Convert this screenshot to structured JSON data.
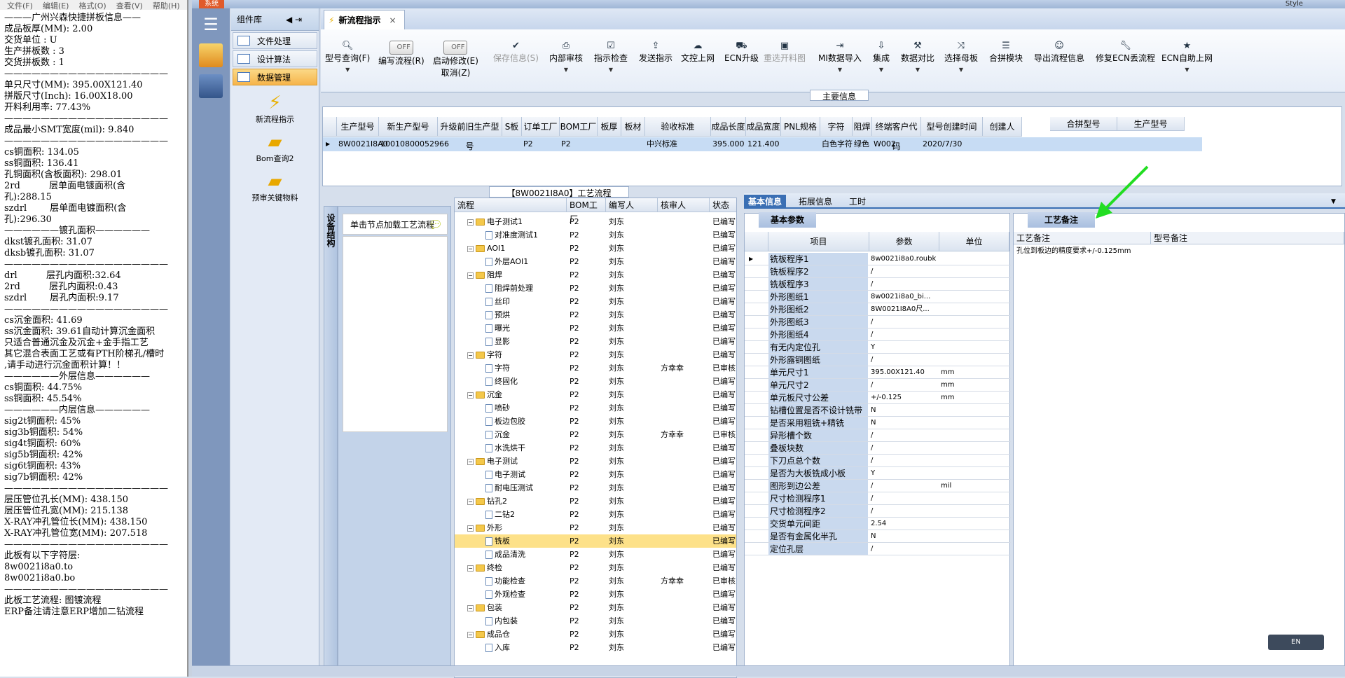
{
  "notepad": {
    "menu": [
      "文件(F)",
      "编辑(E)",
      "格式(O)",
      "查看(V)",
      "帮助(H)"
    ],
    "lines": [
      "———广州兴森快捷拼板信息——",
      "成品板厚(MM): 2.00",
      "交货单位 : U",
      "生产拼板数 : 3",
      "交货拼板数 : 1",
      "——————————————————",
      "单只尺寸(MM): 395.00X121.40",
      "拼版尺寸(Inch): 16.00X18.00",
      "开料利用率: 77.43%",
      "——————————————————",
      "成品最小SMT宽度(mil): 9.840",
      "——————————————————",
      "cs铜面积: 134.05",
      "ss铜面积: 136.41",
      "孔铜面积(含板面积): 298.01",
      "2rd          层单面电镀面积(含",
      "孔):288.15",
      "szdrl        层单面电镀面积(含",
      "孔):296.30",
      "",
      "——————镀孔面积——————",
      "dkst镀孔面积: 31.07",
      "dksb镀孔面积: 31.07",
      "",
      "——————————————————",
      "drl          层孔内面积:32.64",
      "2rd          层孔内面积:0.43",
      "szdrl        层孔内面积:9.17",
      "——————————————————",
      "",
      "cs沉金面积: 41.69",
      "ss沉金面积: 39.61自动计算沉金面积",
      "只适合普通沉金及沉金+金手指工艺",
      "其它混合表面工艺或有PTH阶梯孔/槽时",
      ",请手动进行沉金面积计算！！",
      "——————外层信息——————",
      "cs铜面积: 44.75%",
      "ss铜面积: 45.54%",
      "——————内层信息——————",
      "sig2t铜面积: 45%",
      "sig3b铜面积: 54%",
      "sig4t铜面积: 60%",
      "sig5b铜面积: 42%",
      "sig6t铜面积: 43%",
      "sig7b铜面积: 42%",
      "——————————————————",
      "层压管位孔长(MM): 438.150",
      "层压管位孔宽(MM): 215.138",
      "",
      "X-RAY冲孔管位长(MM): 438.150",
      "X-RAY冲孔管位宽(MM): 207.518",
      "",
      "——————————————————",
      "此板有以下字符层:",
      "8w0021i8a0.to",
      "8w0021i8a0.bo",
      "",
      "——————————————————",
      "此板工艺流程: 图镀流程",
      "ERP备注请注意ERP增加二钻流程"
    ]
  },
  "app": {
    "system_label": "系统",
    "style_label": "Style",
    "component_library": "组件库",
    "nav_items": [
      "文件处理",
      "设计算法",
      "数据管理"
    ],
    "big_icons": [
      "新流程指示",
      "Bom查询2",
      "预审关键物料"
    ],
    "doc_tab": "新流程指示",
    "ribbon": {
      "buttons": [
        {
          "label": "型号查询(F)",
          "icon": "search-icon"
        },
        {
          "label": "编写流程(R)",
          "toggle": "OFF"
        },
        {
          "label": "启动修改(E)",
          "label2": "取消(Z)",
          "toggle": "OFF"
        },
        {
          "label": "保存信息(S)",
          "icon": "check-icon",
          "disabled": true
        },
        {
          "label": "内部审核",
          "icon": "print-icon"
        },
        {
          "label": "指示检查",
          "icon": "checkbox-icon"
        },
        {
          "label": "发送指示",
          "icon": "upload-icon"
        },
        {
          "label": "文控上网",
          "icon": "cloud-icon"
        },
        {
          "label": "ECN升级",
          "icon": "car-icon"
        },
        {
          "label": "重选开料图",
          "icon": "image-icon",
          "disabled": true
        },
        {
          "label": "MI数据导入",
          "icon": "import-icon"
        },
        {
          "label": "集成",
          "icon": "download-icon"
        },
        {
          "label": "数据对比",
          "icon": "tools-icon"
        },
        {
          "label": "选择母板",
          "icon": "shuffle-icon"
        },
        {
          "label": "合拼模块",
          "icon": "list-icon"
        },
        {
          "label": "导出流程信息",
          "icon": "smile-icon"
        },
        {
          "label": "修复ECN丢流程",
          "icon": "wrench-icon"
        },
        {
          "label": "ECN自助上网",
          "icon": "star-icon"
        }
      ]
    },
    "main_info_label": "主要信息",
    "main_grid": {
      "headers": [
        "生产型号",
        "新生产型号",
        "升级前旧生产型号",
        "S板",
        "订单工厂",
        "BOM工厂",
        "板厚",
        "板材",
        "验收标准",
        "成品长度",
        "成品宽度",
        "PNL规格",
        "字符",
        "阻焊",
        "终端客户代码",
        "型号创建时间",
        "创建人"
      ],
      "row": [
        "8W0021I8A0",
        "10010800052966",
        "",
        "",
        "P2",
        "P2",
        "",
        "",
        "中兴标准",
        "395.000",
        "121.400",
        "",
        "白色字符",
        "绿色",
        "W002",
        "2020/7/30",
        ""
      ],
      "right_headers": [
        "合拼型号",
        "生产型号"
      ]
    },
    "process_title": "【8W0021I8A0】工艺流程",
    "side_tab": "设备结构",
    "node_hint": "单击节点加载工艺流程",
    "tree": {
      "headers": [
        "流程",
        "BOM工厂",
        "编写人",
        "核审人",
        "状态"
      ],
      "rows": [
        {
          "level": 1,
          "name": "电子测试1",
          "factory": "P2",
          "writer": "刘东",
          "reviewer": "",
          "status": "已编写"
        },
        {
          "level": 2,
          "name": "对准度测试1",
          "factory": "P2",
          "writer": "刘东",
          "reviewer": "",
          "status": "已编写"
        },
        {
          "level": 1,
          "name": "AOI1",
          "factory": "P2",
          "writer": "刘东",
          "reviewer": "",
          "status": "已编写"
        },
        {
          "level": 2,
          "name": "外层AOI1",
          "factory": "P2",
          "writer": "刘东",
          "reviewer": "",
          "status": "已编写"
        },
        {
          "level": 1,
          "name": "阻焊",
          "factory": "P2",
          "writer": "刘东",
          "reviewer": "",
          "status": "已编写"
        },
        {
          "level": 2,
          "name": "阻焊前处理",
          "factory": "P2",
          "writer": "刘东",
          "reviewer": "",
          "status": "已编写"
        },
        {
          "level": 2,
          "name": "丝印",
          "factory": "P2",
          "writer": "刘东",
          "reviewer": "",
          "status": "已编写"
        },
        {
          "level": 2,
          "name": "预烘",
          "factory": "P2",
          "writer": "刘东",
          "reviewer": "",
          "status": "已编写"
        },
        {
          "level": 2,
          "name": "曝光",
          "factory": "P2",
          "writer": "刘东",
          "reviewer": "",
          "status": "已编写"
        },
        {
          "level": 2,
          "name": "显影",
          "factory": "P2",
          "writer": "刘东",
          "reviewer": "",
          "status": "已编写"
        },
        {
          "level": 1,
          "name": "字符",
          "factory": "P2",
          "writer": "刘东",
          "reviewer": "",
          "status": "已编写"
        },
        {
          "level": 2,
          "name": "字符",
          "factory": "P2",
          "writer": "刘东",
          "reviewer": "方幸幸",
          "status": "已审核"
        },
        {
          "level": 2,
          "name": "终固化",
          "factory": "P2",
          "writer": "刘东",
          "reviewer": "",
          "status": "已编写"
        },
        {
          "level": 1,
          "name": "沉金",
          "factory": "P2",
          "writer": "刘东",
          "reviewer": "",
          "status": "已编写"
        },
        {
          "level": 2,
          "name": "喷砂",
          "factory": "P2",
          "writer": "刘东",
          "reviewer": "",
          "status": "已编写"
        },
        {
          "level": 2,
          "name": "板边包胶",
          "factory": "P2",
          "writer": "刘东",
          "reviewer": "",
          "status": "已编写"
        },
        {
          "level": 2,
          "name": "沉金",
          "factory": "P2",
          "writer": "刘东",
          "reviewer": "方幸幸",
          "status": "已审核"
        },
        {
          "level": 2,
          "name": "水洗烘干",
          "factory": "P2",
          "writer": "刘东",
          "reviewer": "",
          "status": "已编写"
        },
        {
          "level": 1,
          "name": "电子测试",
          "factory": "P2",
          "writer": "刘东",
          "reviewer": "",
          "status": "已编写"
        },
        {
          "level": 2,
          "name": "电子测试",
          "factory": "P2",
          "writer": "刘东",
          "reviewer": "",
          "status": "已编写"
        },
        {
          "level": 2,
          "name": "耐电压测试",
          "factory": "P2",
          "writer": "刘东",
          "reviewer": "",
          "status": "已编写"
        },
        {
          "level": 1,
          "name": "钻孔2",
          "factory": "P2",
          "writer": "刘东",
          "reviewer": "",
          "status": "已编写"
        },
        {
          "level": 2,
          "name": "二钻2",
          "factory": "P2",
          "writer": "刘东",
          "reviewer": "",
          "status": "已编写"
        },
        {
          "level": 1,
          "name": "外形",
          "factory": "P2",
          "writer": "刘东",
          "reviewer": "",
          "status": "已编写"
        },
        {
          "level": 2,
          "name": "铣板",
          "factory": "P2",
          "writer": "刘东",
          "reviewer": "",
          "status": "已编写",
          "selected": true
        },
        {
          "level": 2,
          "name": "成品清洗",
          "factory": "P2",
          "writer": "刘东",
          "reviewer": "",
          "status": "已编写"
        },
        {
          "level": 1,
          "name": "终检",
          "factory": "P2",
          "writer": "刘东",
          "reviewer": "",
          "status": "已编写"
        },
        {
          "level": 2,
          "name": "功能检查",
          "factory": "P2",
          "writer": "刘东",
          "reviewer": "方幸幸",
          "status": "已审核"
        },
        {
          "level": 2,
          "name": "外观检查",
          "factory": "P2",
          "writer": "刘东",
          "reviewer": "",
          "status": "已编写"
        },
        {
          "level": 1,
          "name": "包装",
          "factory": "P2",
          "writer": "刘东",
          "reviewer": "",
          "status": "已编写"
        },
        {
          "level": 2,
          "name": "内包装",
          "factory": "P2",
          "writer": "刘东",
          "reviewer": "",
          "status": "已编写"
        },
        {
          "level": 1,
          "name": "成品仓",
          "factory": "P2",
          "writer": "刘东",
          "reviewer": "",
          "status": "已编写"
        },
        {
          "level": 2,
          "name": "入库",
          "factory": "P2",
          "writer": "刘东",
          "reviewer": "",
          "status": "已编写"
        }
      ]
    },
    "detail_tabs": [
      "基本信息",
      "拓展信息",
      "工时"
    ],
    "basic": {
      "title": "基本参数",
      "headers": [
        "项目",
        "参数",
        "单位"
      ],
      "rows": [
        {
          "item": "铣板程序1",
          "value": "8w0021i8a0.roubk",
          "unit": ""
        },
        {
          "item": "铣板程序2",
          "value": "/",
          "unit": ""
        },
        {
          "item": "铣板程序3",
          "value": "/",
          "unit": ""
        },
        {
          "item": "外形图纸1",
          "value": "8w0021i8a0_bi...",
          "unit": ""
        },
        {
          "item": "外形图纸2",
          "value": "8W0021I8A0尺...",
          "unit": ""
        },
        {
          "item": "外形图纸3",
          "value": "/",
          "unit": ""
        },
        {
          "item": "外形图纸4",
          "value": "/",
          "unit": ""
        },
        {
          "item": "有无内定位孔",
          "value": "Y",
          "unit": ""
        },
        {
          "item": "外形露铜图纸",
          "value": "/",
          "unit": ""
        },
        {
          "item": "单元尺寸1",
          "value": "395.00X121.40",
          "unit": "mm"
        },
        {
          "item": "单元尺寸2",
          "value": "/",
          "unit": "mm"
        },
        {
          "item": "单元板尺寸公差",
          "value": "+/-0.125",
          "unit": "mm"
        },
        {
          "item": "钻槽位置是否不设计铣带",
          "value": "N",
          "unit": ""
        },
        {
          "item": "是否采用粗铣+精铣",
          "value": "N",
          "unit": ""
        },
        {
          "item": "异形槽个数",
          "value": "/",
          "unit": ""
        },
        {
          "item": "叠板块数",
          "value": "/",
          "unit": ""
        },
        {
          "item": "下刀点总个数",
          "value": "/",
          "unit": ""
        },
        {
          "item": "是否为大板铣成小板",
          "value": "Y",
          "unit": ""
        },
        {
          "item": "图形到边公差",
          "value": "/",
          "unit": "mil"
        },
        {
          "item": "尺寸检测程序1",
          "value": "/",
          "unit": ""
        },
        {
          "item": "尺寸检测程序2",
          "value": "/",
          "unit": ""
        },
        {
          "item": "交货单元间距",
          "value": "2.54",
          "unit": ""
        },
        {
          "item": "是否有金属化半孔",
          "value": "N",
          "unit": ""
        },
        {
          "item": "定位孔层",
          "value": "/",
          "unit": ""
        }
      ]
    },
    "remarks": {
      "title": "工艺备注",
      "headers": [
        "工艺备注",
        "型号备注"
      ],
      "text": "孔位到板边的精度要求+/-0.125mm"
    },
    "ime": "EN"
  }
}
